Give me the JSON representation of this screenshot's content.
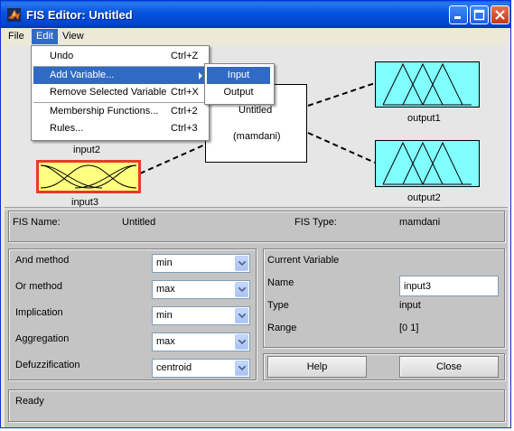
{
  "window": {
    "title": "FIS Editor: Untitled",
    "controls": [
      "minimize-icon",
      "maximize-icon",
      "close-icon"
    ]
  },
  "menubar": {
    "items": [
      {
        "label": "File"
      },
      {
        "label": "Edit"
      },
      {
        "label": "View"
      }
    ]
  },
  "edit_menu": {
    "items": [
      {
        "label": "Undo",
        "shortcut": "Ctrl+Z"
      },
      {
        "label": "Add Variable...",
        "shortcut": ""
      },
      {
        "label": "Remove Selected Variable",
        "shortcut": "Ctrl+X"
      },
      {
        "label": "Membership Functions...",
        "shortcut": "Ctrl+2"
      },
      {
        "label": "Rules...",
        "shortcut": "Ctrl+3"
      }
    ],
    "submenu": [
      {
        "label": "Input"
      },
      {
        "label": "Output"
      }
    ]
  },
  "diagram": {
    "inputs": [
      {
        "name": "input2"
      },
      {
        "name": "input3"
      }
    ],
    "system": {
      "name": "Untitled",
      "type": "(mamdani)"
    },
    "outputs": [
      {
        "name": "output1"
      },
      {
        "name": "output2"
      }
    ],
    "colors": {
      "output_fill": "#80ffff",
      "input_selected_fill": "#ffff80",
      "selection_border": "#ff0000"
    }
  },
  "fis_info": {
    "name_label": "FIS Name:",
    "name_value": "Untitled",
    "type_label": "FIS Type:",
    "type_value": "mamdani"
  },
  "methods": [
    {
      "label": "And method",
      "value": "min"
    },
    {
      "label": "Or method",
      "value": "max"
    },
    {
      "label": "Implication",
      "value": "min"
    },
    {
      "label": "Aggregation",
      "value": "max"
    },
    {
      "label": "Defuzzification",
      "value": "centroid"
    }
  ],
  "current_variable": {
    "heading": "Current Variable",
    "name_label": "Name",
    "name_value": "input3",
    "type_label": "Type",
    "type_value": "input",
    "range_label": "Range",
    "range_value": "[0 1]"
  },
  "buttons": {
    "help": "Help",
    "close": "Close"
  },
  "status": {
    "text": "Ready"
  }
}
